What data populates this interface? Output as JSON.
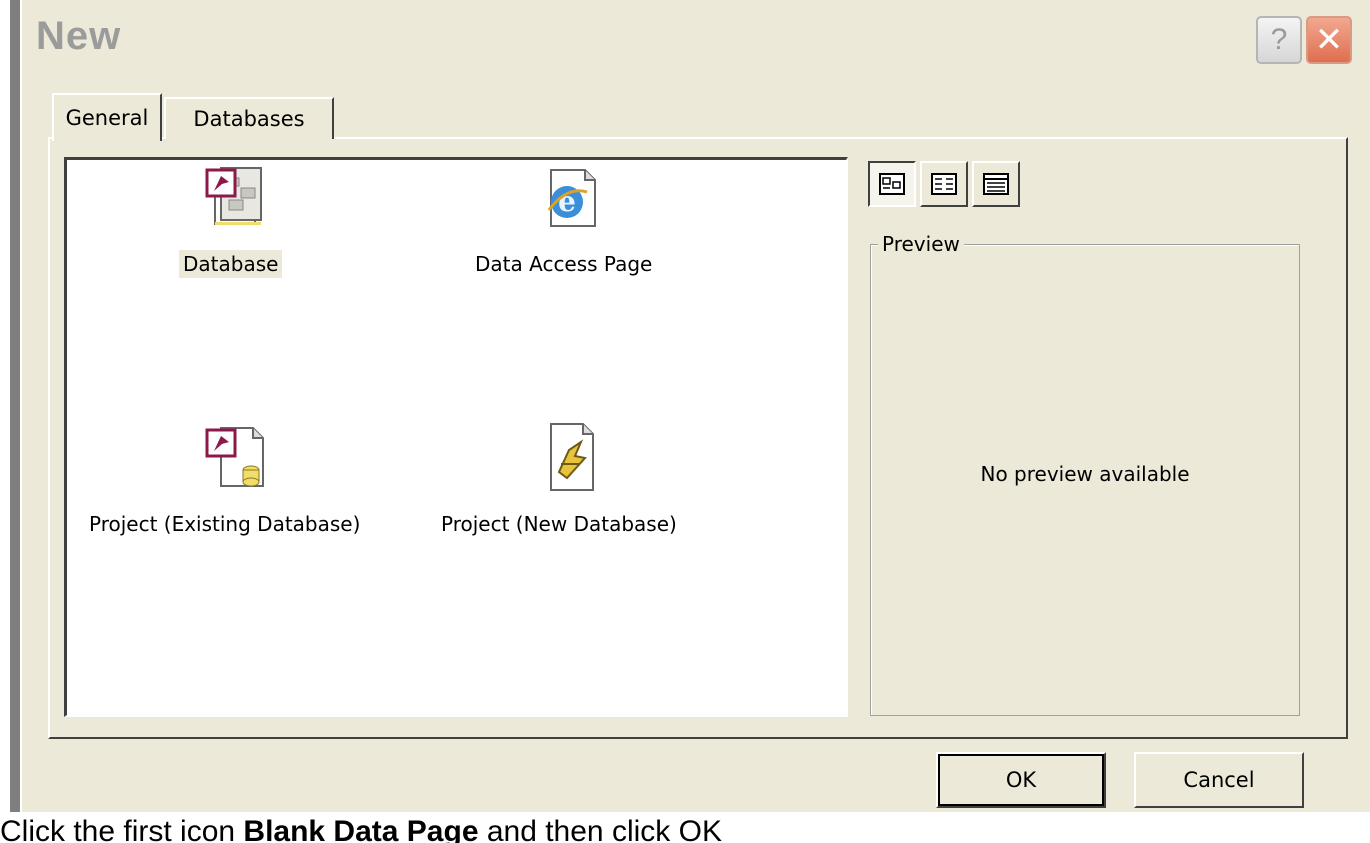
{
  "window": {
    "title": "New",
    "help_label": "?",
    "close_label": "✕"
  },
  "tabs": [
    {
      "label": "General",
      "active": true
    },
    {
      "label": "Databases",
      "active": false
    }
  ],
  "items": [
    {
      "label": "Database",
      "icon": "access-database-icon",
      "selected": true
    },
    {
      "label": "Data Access Page",
      "icon": "data-access-page-icon",
      "selected": false
    },
    {
      "label": "Project (Existing Database)",
      "icon": "project-existing-database-icon",
      "selected": false
    },
    {
      "label": "Project (New Database)",
      "icon": "project-new-database-icon",
      "selected": false
    }
  ],
  "view_buttons": [
    {
      "icon": "large-icons-view-icon",
      "pressed": true
    },
    {
      "icon": "list-view-icon",
      "pressed": false
    },
    {
      "icon": "details-view-icon",
      "pressed": false
    }
  ],
  "preview": {
    "legend": "Preview",
    "text": "No preview available"
  },
  "buttons": {
    "ok": "OK",
    "cancel": "Cancel"
  },
  "caption": {
    "prefix": "Click the first icon ",
    "bold": "Blank Data Page",
    "suffix": " and then click OK"
  },
  "colors": {
    "dialog_bg": "#ece9d8",
    "close_red": "#e06e4f",
    "access_maroon": "#8b1a4a"
  }
}
